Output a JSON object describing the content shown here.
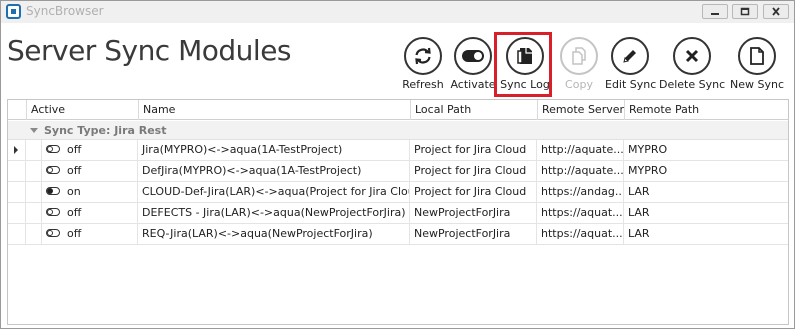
{
  "window": {
    "title": "SyncBrowser"
  },
  "header": {
    "title": "Server Sync Modules"
  },
  "toolbar": {
    "refresh": "Refresh",
    "activate": "Activate",
    "sync_log": "Sync Log",
    "copy": "Copy",
    "edit_sync": "Edit Sync",
    "delete_sync": "Delete Sync",
    "new_sync": "New Sync"
  },
  "grid": {
    "columns": [
      "Active",
      "Name",
      "Local Path",
      "Remote Server",
      "Remote Path"
    ],
    "group_label": "Sync Type: Jira Rest",
    "rows": [
      {
        "active": "off",
        "name": "Jira(MYPRO)<->aqua(1A-TestProject)",
        "local_path": "Project for Jira Cloud",
        "remote_server": "http://aquate...",
        "remote_path": "MYPRO"
      },
      {
        "active": "off",
        "name": "DefJira(MYPRO)<->aqua(1A-TestProject)",
        "local_path": "Project for Jira Cloud",
        "remote_server": "http://aquate...",
        "remote_path": "MYPRO"
      },
      {
        "active": "on",
        "name": "CLOUD-Def-Jira(LAR)<->aqua(Project for Jira Cloud)",
        "local_path": "Project for Jira Cloud",
        "remote_server": "https://andag...",
        "remote_path": "LAR"
      },
      {
        "active": "off",
        "name": "DEFECTS - Jira(LAR)<->aqua(NewProjectForJira)",
        "local_path": "NewProjectForJira",
        "remote_server": "https://aquat...",
        "remote_path": "LAR"
      },
      {
        "active": "off",
        "name": "REQ-Jira(LAR)<->aqua(NewProjectForJira)",
        "local_path": "NewProjectForJira",
        "remote_server": "https://aquat...",
        "remote_path": "LAR"
      }
    ]
  },
  "colors": {
    "highlight": "#d8202a",
    "app_icon": "#1e6fb0"
  }
}
